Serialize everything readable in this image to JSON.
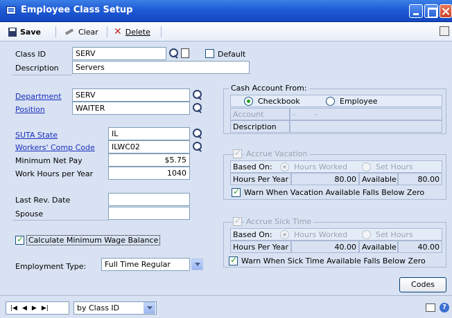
{
  "window": {
    "title": "Employee Class Setup"
  },
  "toolbar": {
    "save": "Save",
    "clear": "Clear",
    "delete": "Delete"
  },
  "class": {
    "id_label": "Class ID",
    "id_value": "SERV",
    "default_label": "Default",
    "default_checked": false,
    "desc_label": "Description",
    "desc_value": "Servers"
  },
  "dept": {
    "label": "Department",
    "value": "SERV"
  },
  "position": {
    "label": "Position",
    "value": "WAITER"
  },
  "suta": {
    "label": "SUTA State",
    "value": "IL"
  },
  "workers_comp": {
    "label": "Workers' Comp Code",
    "value": "ILWC02"
  },
  "min_net_pay": {
    "label": "Minimum Net Pay",
    "value": "$5.75"
  },
  "work_hours": {
    "label": "Work Hours per Year",
    "value": "1040"
  },
  "last_rev": {
    "label": "Last Rev. Date",
    "value": ""
  },
  "spouse": {
    "label": "Spouse",
    "value": ""
  },
  "calc_min_wage": {
    "label": "Calculate Minimum Wage Balance",
    "checked": true
  },
  "employment_type": {
    "label": "Employment Type:",
    "value": "Full Time Regular"
  },
  "cash_account": {
    "title": "Cash Account From:",
    "opt_checkbook": "Checkbook",
    "opt_employee": "Employee",
    "selected": "Checkbook",
    "account_label": "Account",
    "account_value": "-        -",
    "desc_label": "Description",
    "desc_value": ""
  },
  "vacation": {
    "title": "Accrue Vacation",
    "based_on_label": "Based On:",
    "opt_hours_worked": "Hours Worked",
    "opt_set_hours": "Set Hours",
    "hours_label": "Hours Per Year",
    "hours_value": "80.00",
    "available_label": "Available",
    "available_value": "80.00",
    "warn_label": "Warn When Vacation Available Falls Below Zero"
  },
  "sick": {
    "title": "Accrue Sick Time",
    "based_on_label": "Based On:",
    "opt_hours_worked": "Hours Worked",
    "opt_set_hours": "Set Hours",
    "hours_label": "Hours Per Year",
    "hours_value": "40.00",
    "available_label": "Available",
    "available_value": "40.00",
    "warn_label": "Warn When Sick Time Available Falls Below Zero"
  },
  "codes_button": "Codes",
  "statusbar": {
    "nav_glyphs": [
      "|◀",
      "◀",
      "▶",
      "▶|"
    ],
    "sort": "by Class ID"
  },
  "colors": {
    "title_bar": "#1f5bd6",
    "panel": "#d8e2f2",
    "link": "#1a2fbf",
    "check": "#21a121"
  }
}
